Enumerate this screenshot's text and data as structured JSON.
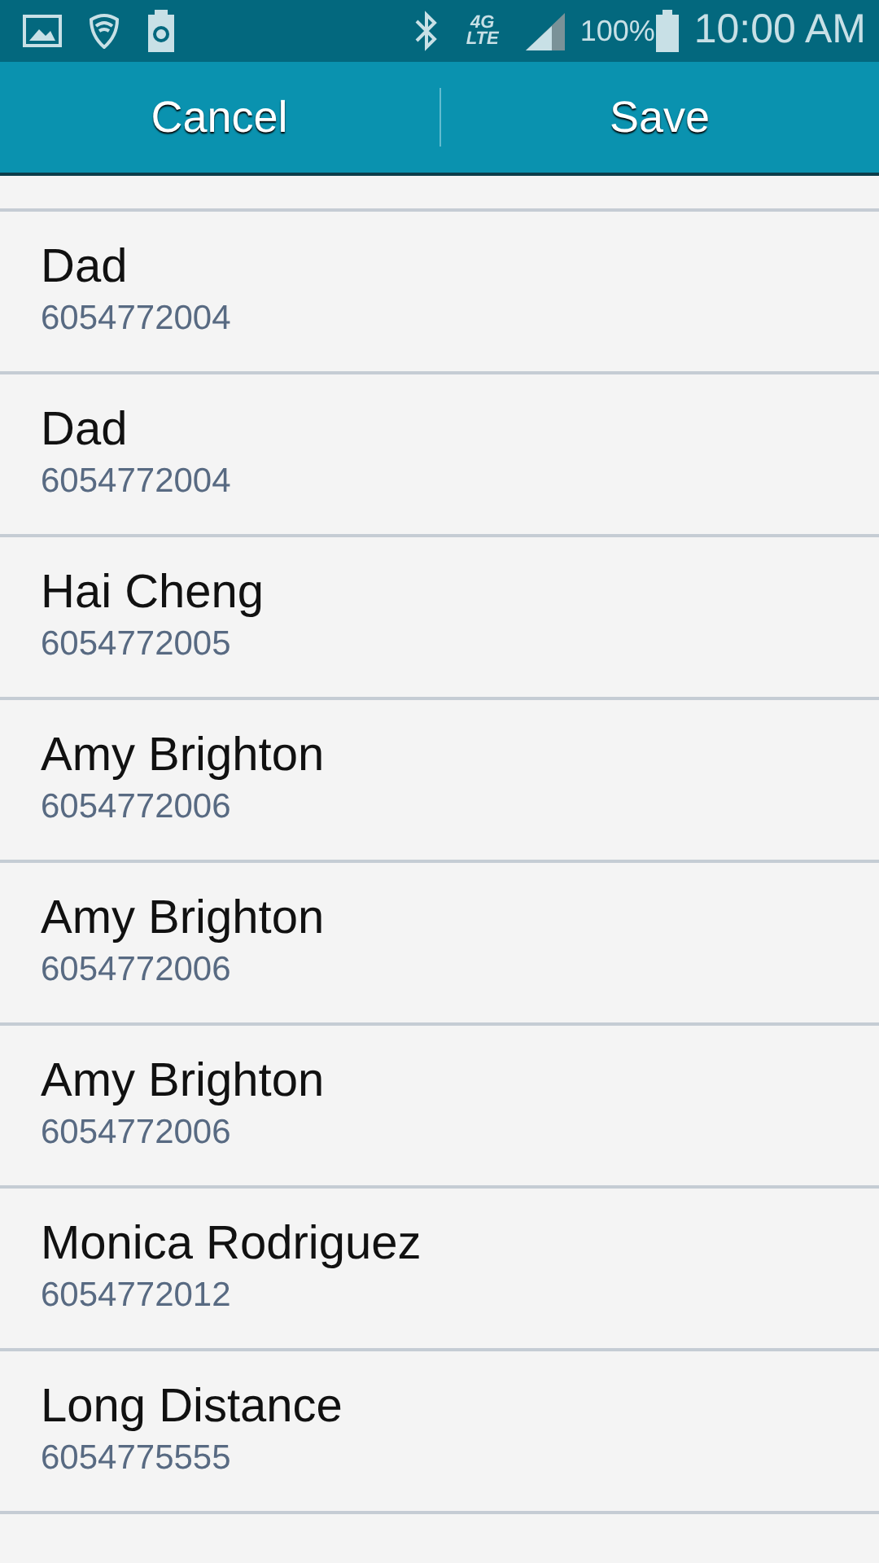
{
  "status_bar": {
    "network_top": "4G",
    "network_bottom": "LTE",
    "battery_text": "100%",
    "time": "10:00 AM"
  },
  "action_bar": {
    "buttons": [
      "Cancel",
      "Save"
    ]
  },
  "contacts": [
    {
      "name": "Dad",
      "number": "6054772004"
    },
    {
      "name": "Dad",
      "number": "6054772004"
    },
    {
      "name": "Hai Cheng",
      "number": "6054772005"
    },
    {
      "name": "Amy Brighton",
      "number": "6054772006"
    },
    {
      "name": "Amy Brighton",
      "number": "6054772006"
    },
    {
      "name": "Amy Brighton",
      "number": "6054772006"
    },
    {
      "name": "Monica Rodriguez",
      "number": "6054772012"
    },
    {
      "name": "Long Distance",
      "number": "6054775555"
    }
  ]
}
